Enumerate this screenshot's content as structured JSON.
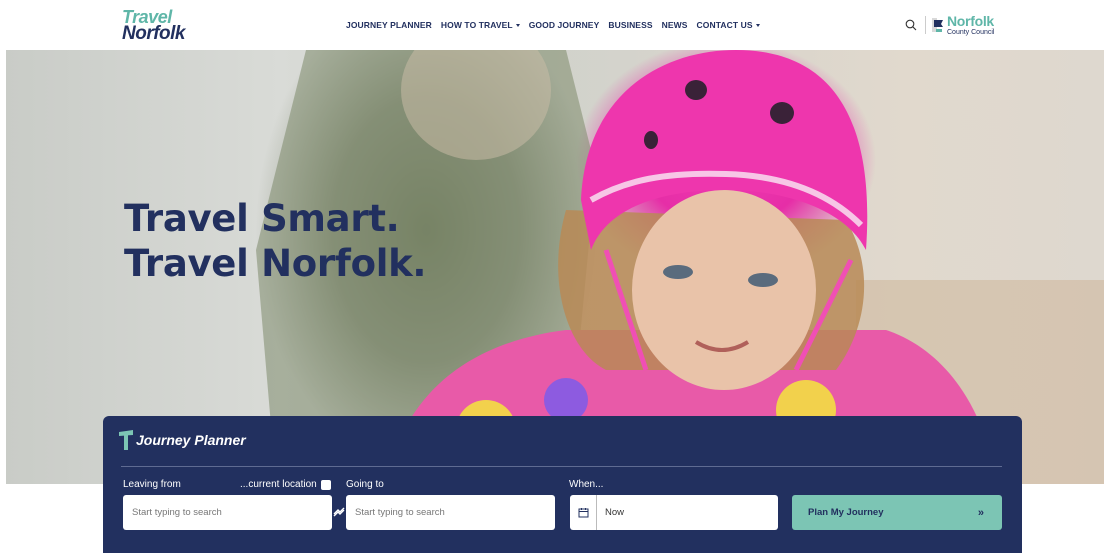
{
  "header": {
    "logo_line1": "Travel",
    "logo_line2": "Norfolk",
    "nav": [
      {
        "label": "JOURNEY PLANNER",
        "has_menu": false
      },
      {
        "label": "HOW TO TRAVEL",
        "has_menu": true
      },
      {
        "label": "GOOD JOURNEY",
        "has_menu": false
      },
      {
        "label": "BUSINESS",
        "has_menu": false
      },
      {
        "label": "NEWS",
        "has_menu": false
      },
      {
        "label": "CONTACT US",
        "has_menu": true
      }
    ],
    "council_line1": "Norfolk",
    "council_line2": "County Council",
    "icons": [
      "search-icon",
      "county-council-logo"
    ]
  },
  "hero": {
    "line1": "Travel Smart.",
    "line2": "Travel Norfolk.",
    "image": "child in pink bicycle helmet and colourful jacket"
  },
  "planner": {
    "title": "Journey Planner",
    "leaving_label": "Leaving from",
    "current_location_label": "...current location",
    "going_label": "Going to",
    "when_label": "When...",
    "leaving_placeholder": "Start typing to search",
    "going_placeholder": "Start typing to search",
    "when_value": "Now",
    "submit_label": "Plan My Journey",
    "submit_icon": "»"
  },
  "colors": {
    "navy": "#22305f",
    "teal": "#5fb6a8",
    "button": "#7cc5b4"
  }
}
